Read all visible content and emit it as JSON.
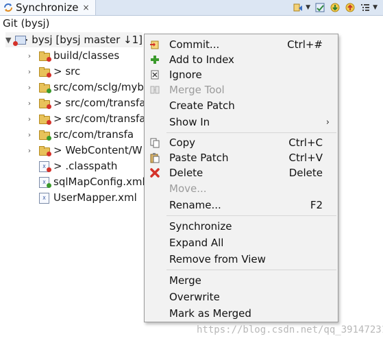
{
  "tab": {
    "title": "Synchronize",
    "close_glyph": "×"
  },
  "toolbar": {
    "icons": [
      "synchronize-icon",
      "dropdown-arrow",
      "commit-icon",
      "pull-icon",
      "push-icon",
      "view-menu-icon"
    ]
  },
  "header": {
    "title": "Git (bysj)"
  },
  "tree": {
    "root": {
      "label": "> bysj [bysj master ↓1]"
    },
    "items": [
      {
        "label": "build/classes",
        "icon": "folder-icon"
      },
      {
        "label": "> src",
        "icon": "folder-icon"
      },
      {
        "label": "src/com/sclg/myb",
        "icon": "folder-icon"
      },
      {
        "label": "> src/com/transfa",
        "icon": "folder-icon"
      },
      {
        "label": "> src/com/transfa",
        "icon": "folder-icon"
      },
      {
        "label": "src/com/transfa",
        "icon": "folder-icon"
      },
      {
        "label": "> WebContent/W",
        "icon": "folder-icon"
      },
      {
        "label": "> .classpath",
        "icon": "xml-file-icon"
      },
      {
        "label": "sqlMapConfig.xml",
        "icon": "xml-file-icon"
      },
      {
        "label": "UserMapper.xml",
        "icon": "xml-file-icon"
      }
    ]
  },
  "context_menu": {
    "commit": {
      "label": "Commit...",
      "shortcut": "Ctrl+#"
    },
    "add_to_index": {
      "label": "Add to Index"
    },
    "ignore": {
      "label": "Ignore"
    },
    "merge_tool": {
      "label": "Merge Tool"
    },
    "create_patch": {
      "label": "Create Patch"
    },
    "show_in": {
      "label": "Show In",
      "submenu_glyph": "›"
    },
    "copy": {
      "label": "Copy",
      "shortcut": "Ctrl+C"
    },
    "paste_patch": {
      "label": "Paste Patch",
      "shortcut": "Ctrl+V"
    },
    "delete": {
      "label": "Delete",
      "shortcut": "Delete"
    },
    "move": {
      "label": "Move..."
    },
    "rename": {
      "label": "Rename...",
      "shortcut": "F2"
    },
    "synchronize": {
      "label": "Synchronize"
    },
    "expand_all": {
      "label": "Expand All"
    },
    "remove_from_view": {
      "label": "Remove from View"
    },
    "merge": {
      "label": "Merge"
    },
    "overwrite": {
      "label": "Overwrite"
    },
    "mark_as_merged": {
      "label": "Mark as Merged"
    }
  },
  "watermark": {
    "text": "https://blog.csdn.net/qq_39147231"
  },
  "colors": {
    "tabbar_bg": "#dce6f3",
    "menu_bg": "#f2f2f2",
    "delete_red": "#d4322a",
    "add_green": "#3b9a2c"
  }
}
